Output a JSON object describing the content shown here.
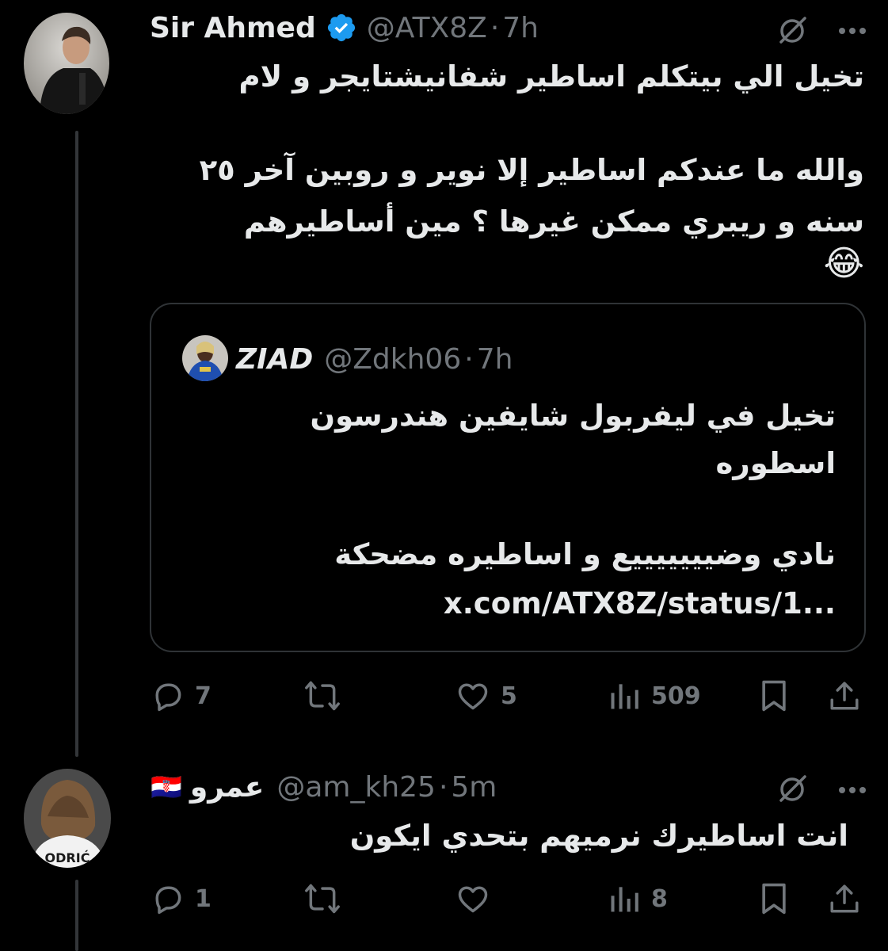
{
  "tweet": {
    "author_name": "Sir Ahmed",
    "verified": true,
    "handle": "@ATX8Z",
    "separator": "·",
    "time": "7h",
    "lines": [
      "تخيل الي بيتكلم اساطير شفانيشتايجر و لام",
      "والله ما عندكم اساطير إلا نوير و روبين آخر ٢٥",
      "سنه و ريبري ممكن غيرها ؟ مين أساطيرهم",
      "😂"
    ],
    "quote": {
      "author_name": "ZIAD",
      "handle": "@Zdkh06",
      "separator": "·",
      "time": "7h",
      "lines": [
        "تخيل في ليفربول شايفين هندرسون",
        "اسطوره",
        "نادي وضيييييييع و اساطيره مضحكة",
        "x.com/ATX8Z/status/1..."
      ]
    },
    "actions": {
      "replies": "7",
      "likes": "5",
      "views": "509"
    }
  },
  "reply": {
    "author_name": "عمرو",
    "flag": "🇭🇷",
    "handle": "@am_kh25",
    "separator": "·",
    "time": "5m",
    "jersey_text": "ODRIĆ",
    "lines": [
      "انت اساطيرك نرميهم بتحدي ايكون"
    ],
    "actions": {
      "replies": "1",
      "views": "8"
    }
  },
  "colors": {
    "background": "#000000",
    "text": "#e7e9ea",
    "secondary": "#71767b",
    "verified": "#1d9bf0",
    "border": "#2f3336"
  }
}
